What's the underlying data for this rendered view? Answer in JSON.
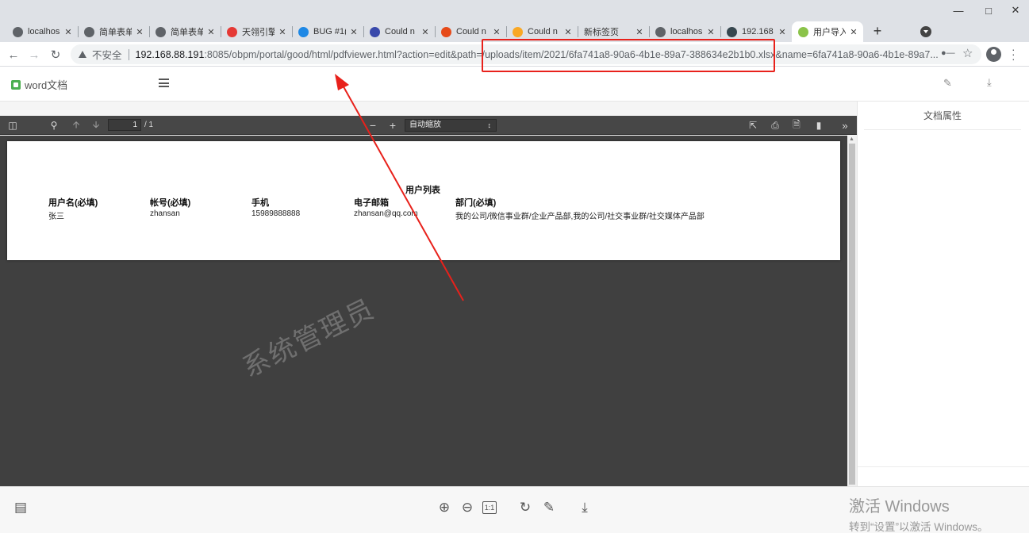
{
  "browser": {
    "tabs": [
      {
        "title": "localhos",
        "fav_color": "#5f6368",
        "fav_icon": "globe-icon"
      },
      {
        "title": "简单表单",
        "fav_color": "#5f6368",
        "fav_icon": "globe-icon"
      },
      {
        "title": "简单表单",
        "fav_color": "#5f6368",
        "fav_icon": "globe-icon"
      },
      {
        "title": "天翎引擎",
        "fav_color": "#e53935",
        "fav_icon": "tianling-icon"
      },
      {
        "title": "BUG #1(",
        "fav_color": "#1e88e5",
        "fav_icon": "bug-icon"
      },
      {
        "title": "Could n",
        "fav_color": "#3949ab",
        "fav_icon": "baidu-icon"
      },
      {
        "title": "Could n",
        "fav_color": "#e64a19",
        "fav_icon": "csdn-icon"
      },
      {
        "title": "Could n",
        "fav_color": "#f9a825",
        "fav_icon": "kotlin-icon"
      },
      {
        "title": "新标签页",
        "fav_color": "",
        "fav_icon": ""
      },
      {
        "title": "localhos",
        "fav_color": "#5f6368",
        "fav_icon": "globe-icon"
      },
      {
        "title": "192.168",
        "fav_color": "#37474f",
        "fav_icon": "image-icon"
      },
      {
        "title": "用户导入",
        "fav_color": "#8bc34a",
        "fav_icon": "w-icon",
        "active": true
      }
    ],
    "new_tab": "+",
    "insecure_label": "不安全",
    "url_host": "192.168.88.191",
    "url_rest": ":8085/obpm/portal/good/html/pdfviewer.html?action=edit&path=/uploads/item/2021/6fa741a8-90a6-4b1e-89a7-388634e2b1b0.xlsx&name=6fa741a8-90a6-4b1e-89a7..."
  },
  "app": {
    "doc_title": "word文档"
  },
  "pdf": {
    "page_current": "1",
    "page_count": "/ 1",
    "zoom_label": "自动缩放",
    "table_title": "用户列表",
    "columns": [
      "用户名(必填)",
      "帐号(必填)",
      "手机",
      "电子邮箱",
      "部门(必填)"
    ],
    "row": [
      "张三",
      "zhansan",
      "15989888888",
      "zhansan@qq.com",
      "我的公司/微信事业群/企业产品部,我的公司/社交事业群/社交媒体产品部"
    ],
    "watermark": "系统管理员"
  },
  "props": {
    "title": "文档属性"
  },
  "os": {
    "activate_line1": "激活 Windows",
    "activate_line2": "转到“设置”以激活 Windows。"
  },
  "colors": {
    "annotation_red": "#e8211b",
    "pdf_background": "#404040",
    "pdf_toolbar": "#474747"
  }
}
